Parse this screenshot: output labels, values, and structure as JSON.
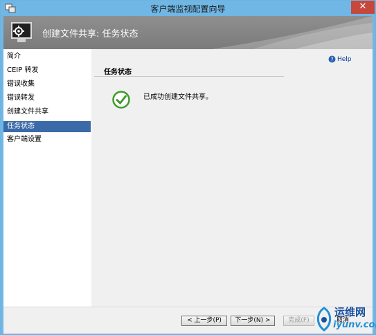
{
  "window": {
    "title": "客户端监视配置向导",
    "close_glyph": "✕"
  },
  "header": {
    "title": "创建文件共享: 任务状态"
  },
  "sidebar": {
    "items": [
      {
        "label": "简介"
      },
      {
        "label": "CEIP 转发"
      },
      {
        "label": "错误收集"
      },
      {
        "label": "错误转发"
      },
      {
        "label": "创建文件共享"
      },
      {
        "label": "任务状态"
      },
      {
        "label": "客户端设置"
      }
    ],
    "active_index": 5
  },
  "content": {
    "help_label": "Help",
    "section_title": "任务状态",
    "status_message": "已成功创建文件共享。"
  },
  "footer": {
    "prev_label": "< 上一步(P)",
    "next_label": "下一步(N) >",
    "finish_label": "完成(F)",
    "cancel_label": "取消"
  },
  "watermark": {
    "line1": "运维网",
    "line2": "iyunv.com"
  },
  "colors": {
    "accent": "#3b6aa8",
    "titlebar": "#70b7e6",
    "success": "#3f9b2b",
    "close": "#c7473a"
  }
}
